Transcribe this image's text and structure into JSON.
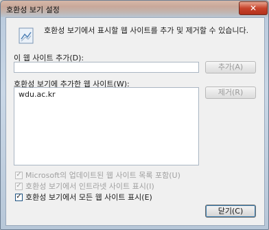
{
  "window": {
    "title": "호환성 보기 설정",
    "close_glyph": "✕"
  },
  "header": {
    "text": "호환성 보기에서 표시할 웹 사이트를 추가 및 제거할 수 있습니다."
  },
  "add_section": {
    "label": "이 웹 사이트 추가(D):",
    "input_value": "",
    "button_label": "추가(A)"
  },
  "list_section": {
    "label": "호환성 보기에 추가한 웹 사이트(W):",
    "items": [
      "wdu.ac.kr"
    ],
    "remove_button_label": "제거(R)"
  },
  "options": {
    "updated_list": {
      "label": "Microsoft의 업데이트된 웹 사이트 목록 포함(U)",
      "checked": true,
      "enabled": false
    },
    "intranet": {
      "label": "호환성 보기에서 인트라넷 사이트 표시(I)",
      "checked": true,
      "enabled": false
    },
    "all_sites": {
      "label": "호환성 보기에서 모든 웹 사이트 표시(E)",
      "checked": true,
      "enabled": true
    }
  },
  "footer": {
    "close_button_label": "닫기(C)"
  },
  "colors": {
    "accent": "#3c7fb1",
    "close_red": "#c7442c"
  }
}
